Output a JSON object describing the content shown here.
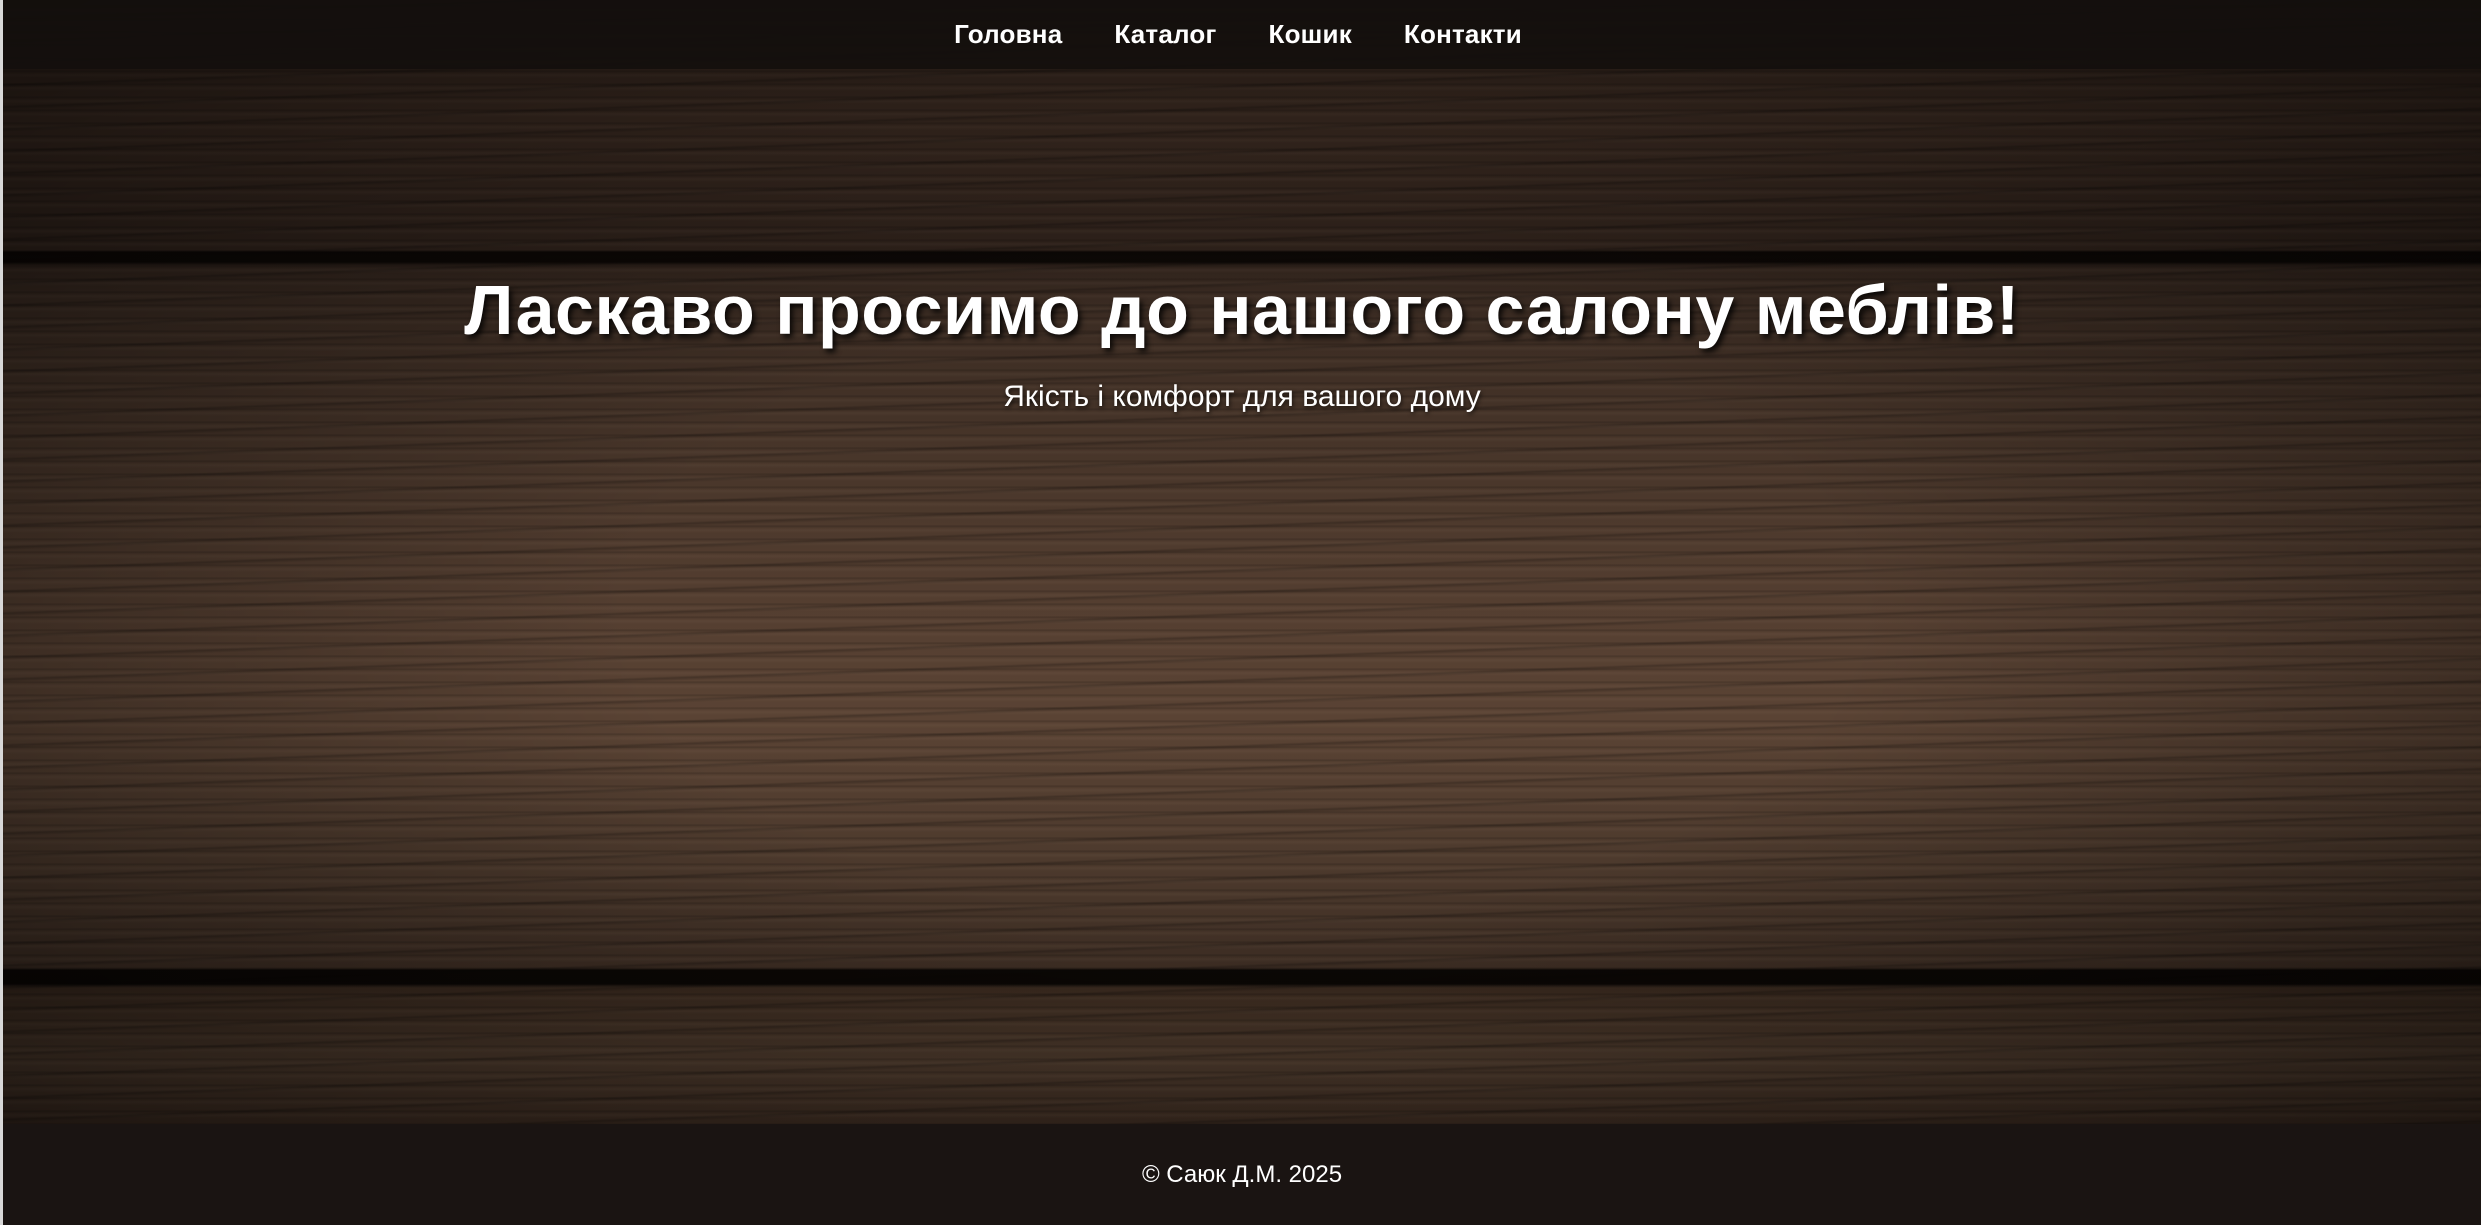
{
  "nav": {
    "items": [
      {
        "label": "Головна"
      },
      {
        "label": "Каталог"
      },
      {
        "label": "Кошик"
      },
      {
        "label": "Контакти"
      }
    ]
  },
  "hero": {
    "title": "Ласкаво просимо до нашого салону меблів!",
    "subtitle": "Якість і комфорт для вашого дому"
  },
  "footer": {
    "copyright": "© Саюк Д.М. 2025"
  },
  "colors": {
    "nav_background": "#14100e",
    "footer_background": "#1a1412",
    "text": "#ffffff",
    "wood": "#3b2a20"
  }
}
